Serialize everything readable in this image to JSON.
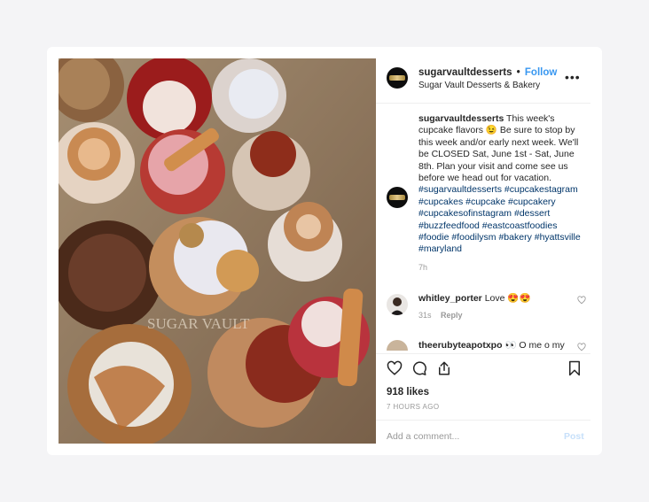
{
  "post": {
    "username": "sugarvaultdesserts",
    "separator": "•",
    "follow_label": "Follow",
    "location": "Sugar Vault Desserts & Bakery",
    "more_label": "•••",
    "photo_watermark": "SUGAR VAULT",
    "photo_alt": "cupcakes",
    "caption": {
      "username": "sugarvaultdesserts",
      "text": "This week's cupcake flavors 😉 Be sure to stop by this week and/or early next week. We'll be CLOSED Sat, June 1st - Sat, June 8th. Plan your visit and come see us before we head out for vacation.",
      "hashtags": "#sugarvaultdesserts #cupcakestagram #cupcakes #cupcake #cupcakery #cupcakesofinstagram #dessert #buzzfeedfood #eastcoastfoodies #foodie #foodilysm #bakery #hyattsville #maryland",
      "time": "7h"
    },
    "comments": [
      {
        "username": "whitley_porter",
        "text": "Love 😍😍",
        "time": "31s",
        "reply_label": "Reply"
      },
      {
        "username": "theerubyteapotxpo",
        "text": "👀 O me o my"
      }
    ],
    "likes": "918 likes",
    "posted_ago": "7 HOURS AGO",
    "add_comment_placeholder": "Add a comment...",
    "post_label": "Post",
    "icons": [
      "heart-icon",
      "comment-icon",
      "share-icon",
      "bookmark-icon",
      "more-icon"
    ]
  },
  "colors": {
    "link": "#3897f0",
    "hashtag": "#003569",
    "post_disabled": "#c7e0fa",
    "background": "#f4f4f6"
  }
}
